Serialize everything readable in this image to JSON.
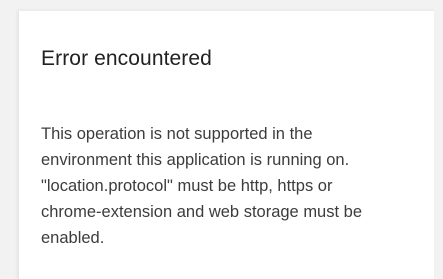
{
  "dialog": {
    "title": "Error encountered",
    "message_lines": [
      "This operation is not supported in the",
      "environment this application is running on.",
      "\"location.protocol\" must be http, https or",
      "chrome-extension and web storage must be",
      "enabled."
    ]
  },
  "colors": {
    "background": "#f2f2f2",
    "dialog_background": "#ffffff",
    "title_text": "#212121",
    "body_text": "#3c3c3c"
  }
}
